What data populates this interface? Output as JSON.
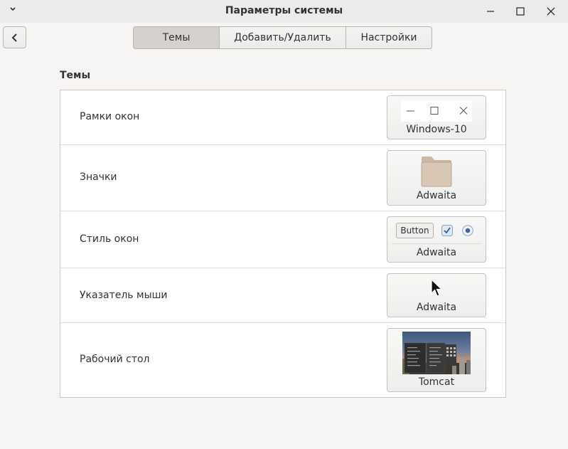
{
  "window": {
    "title": "Параметры системы"
  },
  "tabs": [
    {
      "label": "Темы",
      "active": true
    },
    {
      "label": "Добавить/Удалить",
      "active": false
    },
    {
      "label": "Настройки",
      "active": false
    }
  ],
  "section": {
    "title": "Темы"
  },
  "rows": [
    {
      "label": "Рамки окон",
      "value": "Windows-10",
      "preview": "window-controls-preview"
    },
    {
      "label": "Значки",
      "value": "Adwaita",
      "preview": "folder-icon"
    },
    {
      "label": "Стиль окон",
      "value": "Adwaita",
      "preview": "gtk-widgets-preview",
      "sample_button": "Button"
    },
    {
      "label": "Указатель мыши",
      "value": "Adwaita",
      "preview": "mouse-pointer-icon"
    },
    {
      "label": "Рабочий стол",
      "value": "Tomcat",
      "preview": "desktop-theme-thumbnail"
    }
  ],
  "colors": {
    "accent": "#3584e4",
    "window_bg": "#f6f5f4",
    "titlebar_bg": "#ebebeb",
    "active_tab": "#d6d1cd"
  }
}
